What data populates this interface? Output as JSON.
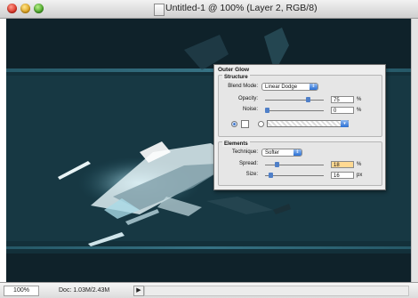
{
  "window": {
    "title": "Untitled-1 @ 100% (Layer 2, RGB/8)"
  },
  "status_bar": {
    "zoom": "100%",
    "doc_info": "Doc: 1.03M/2.43M",
    "arrow_icon": "triangle-right"
  },
  "dialog": {
    "title": "Outer Glow",
    "structure": {
      "label": "Structure",
      "blend_mode_label": "Blend Mode:",
      "blend_mode_value": "Linear Dodge",
      "opacity_label": "Opacity:",
      "opacity_value": "75",
      "opacity_unit": "%",
      "noise_label": "Noise:",
      "noise_value": "0",
      "noise_unit": "%"
    },
    "elements": {
      "label": "Elements",
      "technique_label": "Technique:",
      "technique_value": "Softer",
      "spread_label": "Spread:",
      "spread_value": "18",
      "spread_unit": "%",
      "size_label": "Size:",
      "size_value": "16",
      "size_unit": "px"
    }
  },
  "colors": {
    "canvas_bg": "#0e1f26",
    "glow_cyan": "#7fd3e8",
    "accent_blue": "#2a6fd4",
    "active_field": "#ffd992"
  }
}
